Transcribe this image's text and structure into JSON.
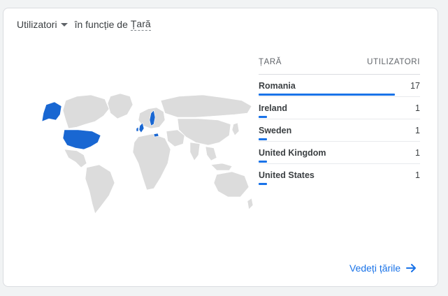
{
  "header": {
    "metric_label": "Utilizatori",
    "connector": "în funcție de",
    "dimension_label": "Țară"
  },
  "table": {
    "col_country": "ȚARĂ",
    "col_users": "UTILIZATORI",
    "rows": [
      {
        "country": "Romania",
        "users": "17",
        "share": 1.0
      },
      {
        "country": "Ireland",
        "users": "1",
        "share": 0.059
      },
      {
        "country": "Sweden",
        "users": "1",
        "share": 0.059
      },
      {
        "country": "United Kingdom",
        "users": "1",
        "share": 0.059
      },
      {
        "country": "United States",
        "users": "1",
        "share": 0.059
      }
    ]
  },
  "footer": {
    "view_link": "Vedeți țările"
  },
  "colors": {
    "accent": "#1a73e8",
    "map_land": "#dcdcdc",
    "map_highlight": "#1967d2"
  },
  "map": {
    "highlighted_countries": [
      "United States",
      "United Kingdom",
      "Ireland",
      "Sweden",
      "Romania"
    ]
  }
}
